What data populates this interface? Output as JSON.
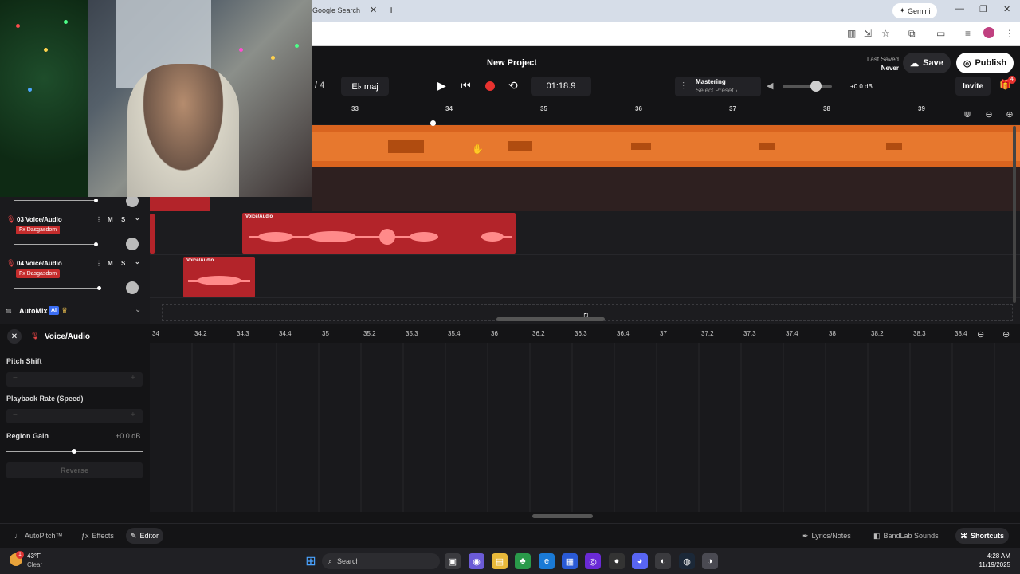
{
  "browser": {
    "tab_title": "Google Search",
    "gemini_label": "Gemini"
  },
  "header": {
    "project_title": "New Project",
    "last_saved_label": "Last Saved",
    "last_saved_value": "Never",
    "save_label": "Save",
    "publish_label": "Publish",
    "bar_count": "/ 4",
    "key": "E♭ maj",
    "time": "01:18.9",
    "mastering_title": "Mastering",
    "mastering_preset": "Select Preset",
    "volume_db": "+0.0 dB",
    "invite_label": "Invite",
    "gift_badge": "4"
  },
  "ruler": {
    "ticks": [
      "33",
      "34",
      "35",
      "36",
      "37",
      "38",
      "39"
    ]
  },
  "tracks": [
    {
      "number": "03",
      "name": "Voice/Audio",
      "fx": "Fx Dasgasdom",
      "mute": "M",
      "solo": "S",
      "clip_label": "Voice/Audio"
    },
    {
      "number": "04",
      "name": "Voice/Audio",
      "fx": "Fx Dasgasdom",
      "mute": "M",
      "solo": "S",
      "clip_label": "Voice/Audio"
    }
  ],
  "automix": {
    "label": "AutoMix",
    "ai_badge": "AI"
  },
  "editor": {
    "title": "Voice/Audio",
    "pitch_shift_label": "Pitch Shift",
    "playback_rate_label": "Playback Rate (Speed)",
    "region_gain_label": "Region Gain",
    "region_gain_value": "+0.0 dB",
    "reverse_label": "Reverse",
    "ticks": [
      "34",
      "34.2",
      "34.3",
      "34.4",
      "35",
      "35.2",
      "35.3",
      "35.4",
      "36",
      "36.2",
      "36.3",
      "36.4",
      "37",
      "37.2",
      "37.3",
      "37.4",
      "38",
      "38.2",
      "38.3",
      "38.4"
    ]
  },
  "footer": {
    "autopitch_label": "AutoPitch™",
    "effects_label": "Effects",
    "editor_label": "Editor",
    "lyrics_label": "Lyrics/Notes",
    "sounds_label": "BandLab Sounds",
    "shortcuts_label": "Shortcuts"
  },
  "taskbar": {
    "weather_temp": "43°F",
    "weather_desc": "Clear",
    "search_placeholder": "Search",
    "time": "4:28 AM",
    "date": "11/19/2025"
  },
  "colors": {
    "accent_orange": "#d9641f",
    "clip_red": "#b3242a",
    "record_red": "#e8322f"
  }
}
